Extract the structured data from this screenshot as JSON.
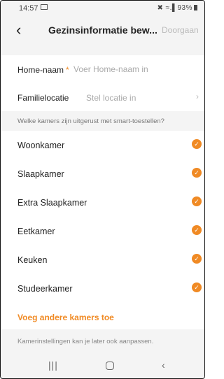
{
  "status_bar": {
    "time": "14:57",
    "right": "✖ ≈.▌93%"
  },
  "header": {
    "back_icon": "‹",
    "title": "Gezinsinformatie bew...",
    "next_label": "Doorgaan"
  },
  "fields": {
    "home_name": {
      "label": "Home-naam",
      "required_mark": "*",
      "placeholder": "Voer Home-naam in"
    },
    "location": {
      "label": "Familielocatie",
      "value": "Stel locatie in",
      "chevron": "›"
    }
  },
  "rooms_section": {
    "header": "Welke kamers zijn uitgerust met smart-toestellen?",
    "check_glyph": "✓",
    "rooms": [
      "Woonkamer",
      "Slaapkamer",
      "Extra Slaapkamer",
      "Eetkamer",
      "Keuken",
      "Studeerkamer"
    ]
  },
  "add_rooms_label": "Voeg andere kamers toe",
  "footer_note": "Kamerinstellingen kan je later ook aanpassen.",
  "nav": {
    "recent": "|||",
    "back": "‹"
  },
  "colors": {
    "accent": "#f08a24",
    "background_gray": "#f4f4f4"
  }
}
